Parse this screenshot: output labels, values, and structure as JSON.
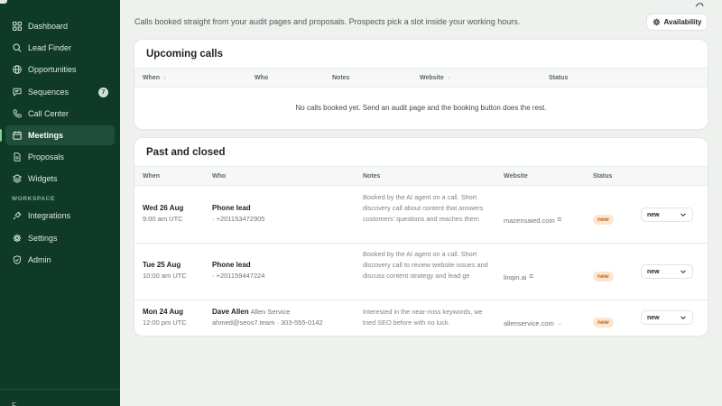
{
  "sidebar": {
    "items": [
      {
        "label": "Dashboard",
        "icon": "grid-icon"
      },
      {
        "label": "Lead Finder",
        "icon": "search-icon"
      },
      {
        "label": "Opportunities",
        "icon": "globe-icon"
      },
      {
        "label": "Sequences",
        "icon": "chat-icon",
        "badge": "7"
      },
      {
        "label": "Call Center",
        "icon": "phone-icon"
      },
      {
        "label": "Meetings",
        "icon": "calendar-icon",
        "active": true
      },
      {
        "label": "Proposals",
        "icon": "document-icon"
      },
      {
        "label": "Widgets",
        "icon": "layers-icon"
      }
    ],
    "section_label": "WORKSPACE",
    "workspace_items": [
      {
        "label": "Integrations",
        "icon": "plug-icon"
      },
      {
        "label": "Settings",
        "icon": "gear-icon"
      },
      {
        "label": "Admin",
        "icon": "shield-icon"
      }
    ],
    "bottom_label": "F"
  },
  "header": {
    "subtitle": "Calls booked straight from your audit pages and proposals. Prospects pick a slot inside your working hours.",
    "availability_label": "Availability"
  },
  "upcoming": {
    "title": "Upcoming calls",
    "columns": [
      "When",
      "Who",
      "Notes",
      "Website",
      "Status"
    ],
    "empty_message": "No calls booked yet. Send an audit page and the booking button does the rest."
  },
  "past": {
    "title": "Past and closed",
    "columns": [
      "When",
      "Who",
      "Notes",
      "Website",
      "Status"
    ],
    "rows": [
      {
        "date": "Wed 26 Aug",
        "time": "9:00 am UTC",
        "who": "Phone lead",
        "company": "",
        "sub": "· +201153472905",
        "notes": "Booked by the AI agent on a call. Short discovery call about content that answers customers' questions and reaches them",
        "website": "mazensaied.com",
        "website_icon": "external-link-icon",
        "status_badge": "new",
        "status_select": "new"
      },
      {
        "date": "Tue 25 Aug",
        "time": "10:00 am UTC",
        "who": "Phone lead",
        "company": "",
        "sub": "· +201159447224",
        "notes": "Booked by the AI agent on a call. Short discovery call to review website issues and discuss content strategy and lead ge",
        "website": "linqin.ai",
        "website_icon": "external-link-icon",
        "status_badge": "new",
        "status_select": "new"
      },
      {
        "date": "Mon 24 Aug",
        "time": "12:00 pm UTC",
        "who": "Dave Allen",
        "company": "Allen Service",
        "sub": "ahmed@seos7.team · 303-555-0142",
        "notes": "Interested in the near-miss keywords, we tried SEO before with no luck.",
        "website": "allenservice.com",
        "website_icon": "arrow-right-icon",
        "status_badge": "new",
        "status_select": "new"
      }
    ]
  },
  "colors": {
    "sidebar_bg": "#0f3a29",
    "sidebar_active": "#1f4e3b",
    "page_bg": "#eef1ee",
    "badge_bg": "#fde6cd",
    "badge_text": "#b5651d"
  }
}
